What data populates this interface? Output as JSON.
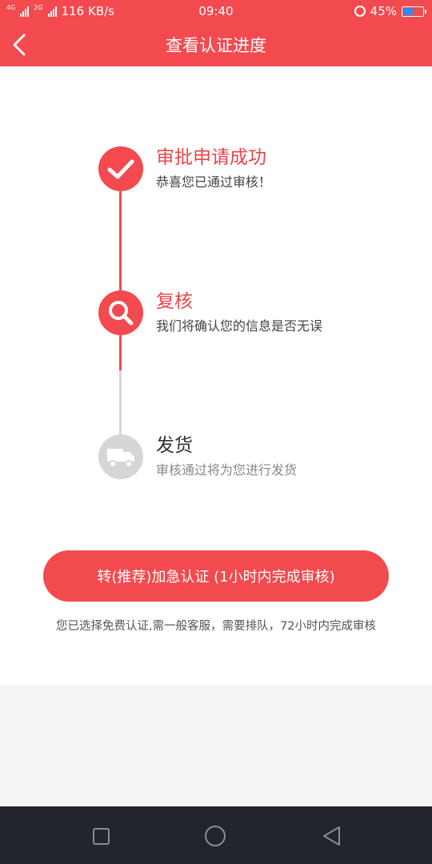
{
  "status_bar": {
    "network_label": "4G",
    "network_label2": "2G",
    "speed": "116 KB/s",
    "time": "09:40",
    "battery": "45%",
    "battery_level": 0.45
  },
  "header": {
    "title": "查看认证进度",
    "back_icon": "chevron-left-icon"
  },
  "steps": [
    {
      "title": "审批申请成功",
      "desc": "恭喜您已通过审核！",
      "icon": "check-icon",
      "state": "done"
    },
    {
      "title": "复核",
      "desc": "我们将确认您的信息是否无误",
      "icon": "search-icon",
      "state": "active"
    },
    {
      "title": "发货",
      "desc": "审核通过将为您进行发货",
      "icon": "truck-icon",
      "state": "pending"
    }
  ],
  "urgent_button": "转(推荐)加急认证 (1小时内完成审核)",
  "note": "您已选择免费认证,需一般客服，需要排队，72小时内完成审核",
  "colors": {
    "accent": "#f24a4f",
    "done_text": "#e8454a",
    "pending": "#d6d6d6",
    "nav_bar": "#23252e"
  }
}
